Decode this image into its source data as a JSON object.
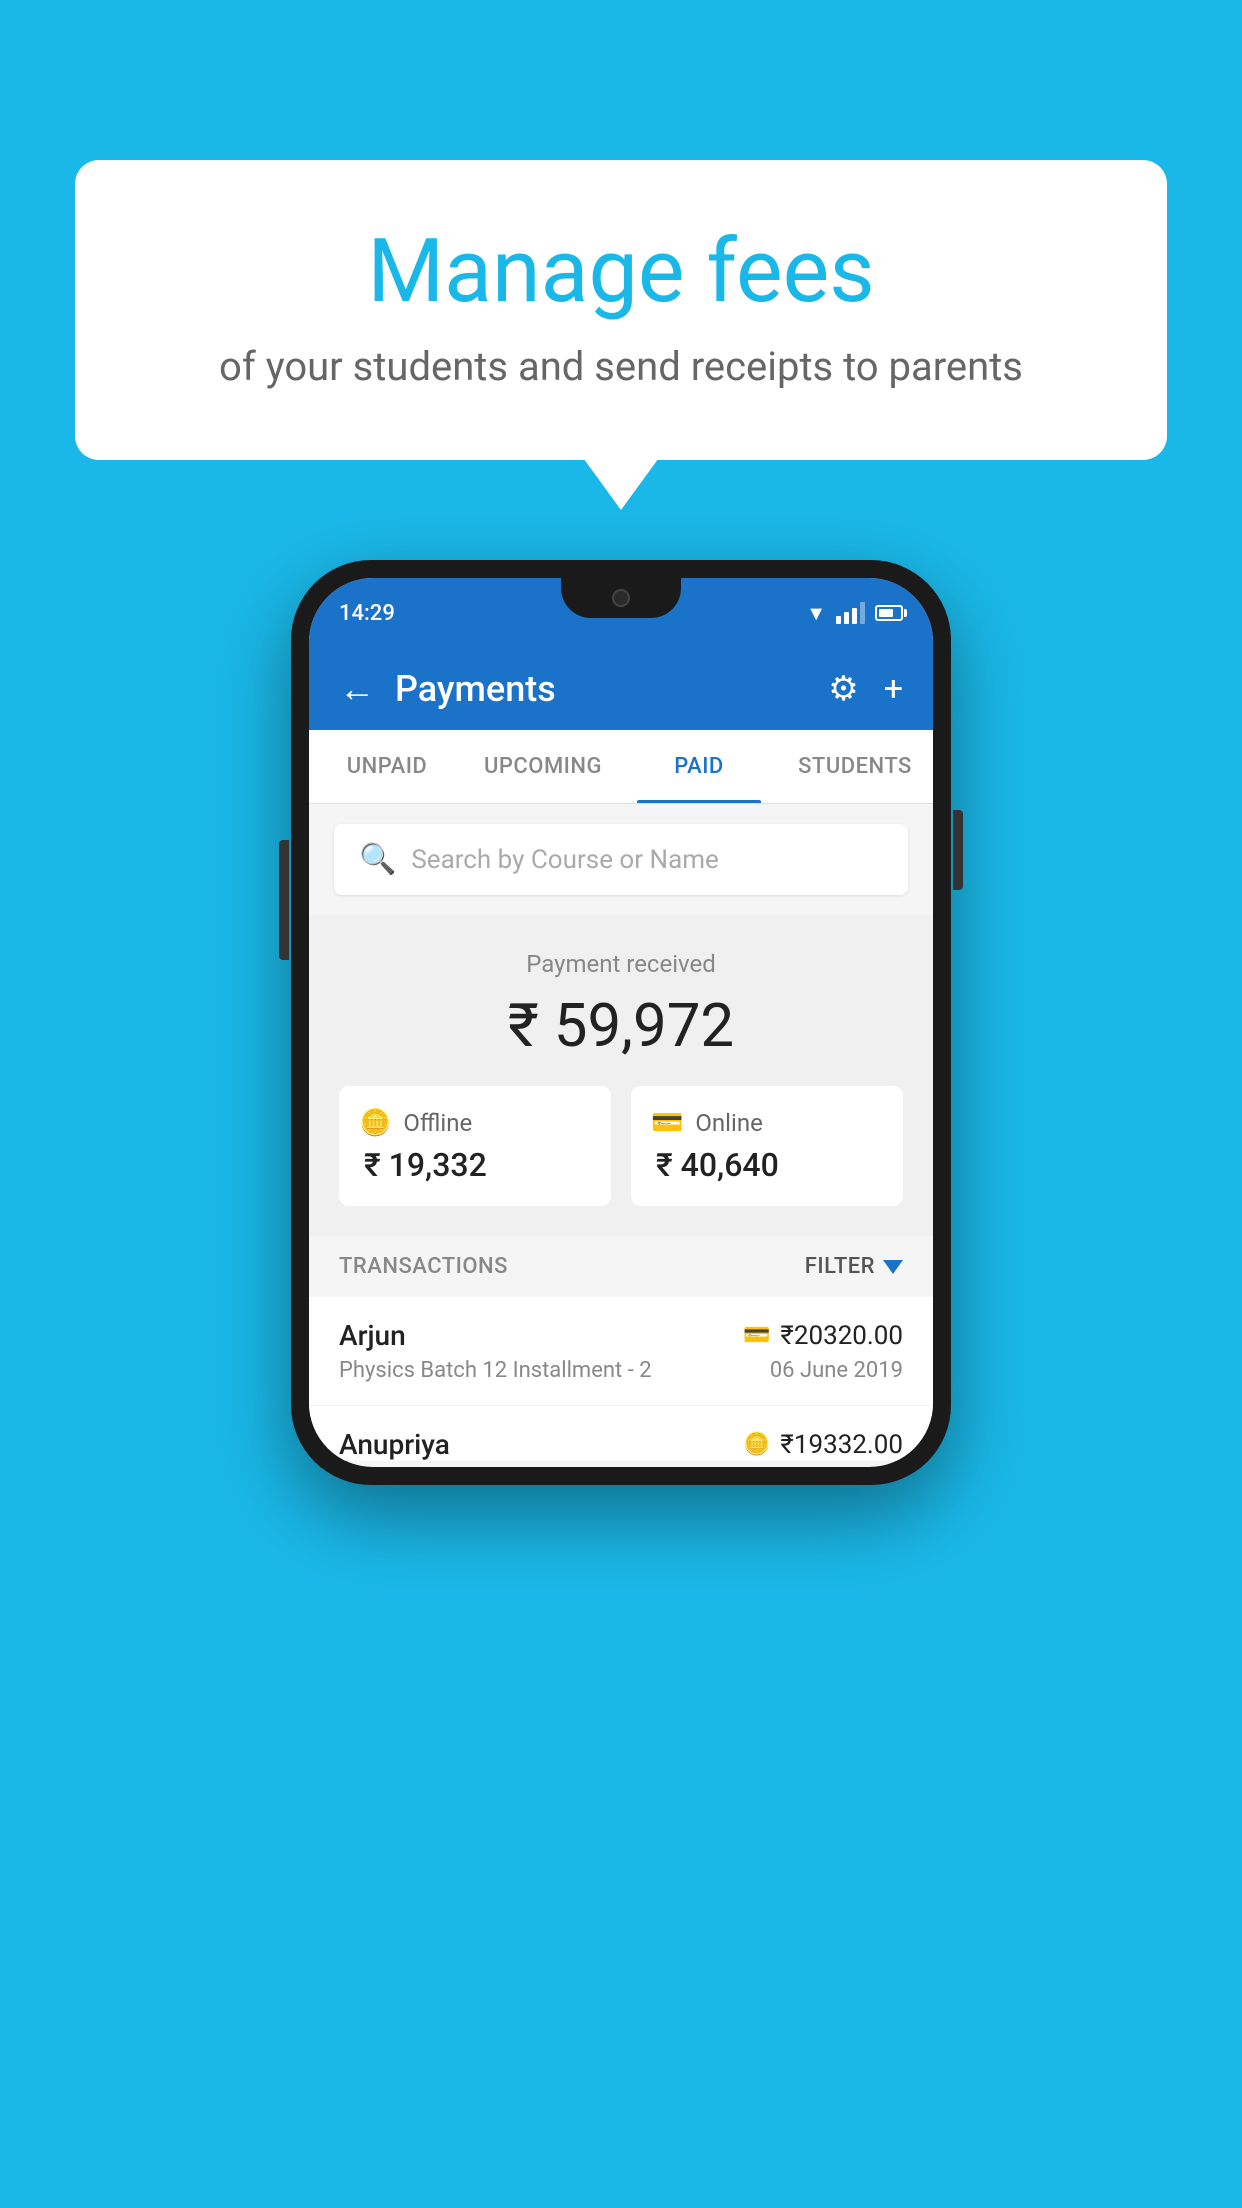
{
  "background_color": "#1ab8e8",
  "bubble": {
    "title": "Manage fees",
    "subtitle": "of your students and send receipts to parents"
  },
  "status_bar": {
    "time": "14:29"
  },
  "header": {
    "title": "Payments",
    "back_label": "←",
    "gear_label": "⚙",
    "plus_label": "+"
  },
  "tabs": [
    {
      "label": "UNPAID",
      "active": false
    },
    {
      "label": "UPCOMING",
      "active": false
    },
    {
      "label": "PAID",
      "active": true
    },
    {
      "label": "STUDENTS",
      "active": false
    }
  ],
  "search": {
    "placeholder": "Search by Course or Name"
  },
  "payment_summary": {
    "label": "Payment received",
    "amount": "₹ 59,972",
    "offline": {
      "type": "Offline",
      "amount": "₹ 19,332"
    },
    "online": {
      "type": "Online",
      "amount": "₹ 40,640"
    }
  },
  "transactions": {
    "label": "TRANSACTIONS",
    "filter_label": "FILTER",
    "items": [
      {
        "name": "Arjun",
        "amount": "₹20320.00",
        "course": "Physics Batch 12 Installment - 2",
        "date": "06 June 2019",
        "method": "card"
      },
      {
        "name": "Anupriya",
        "amount": "₹19332.00",
        "course": "",
        "date": "",
        "method": "cash"
      }
    ]
  }
}
